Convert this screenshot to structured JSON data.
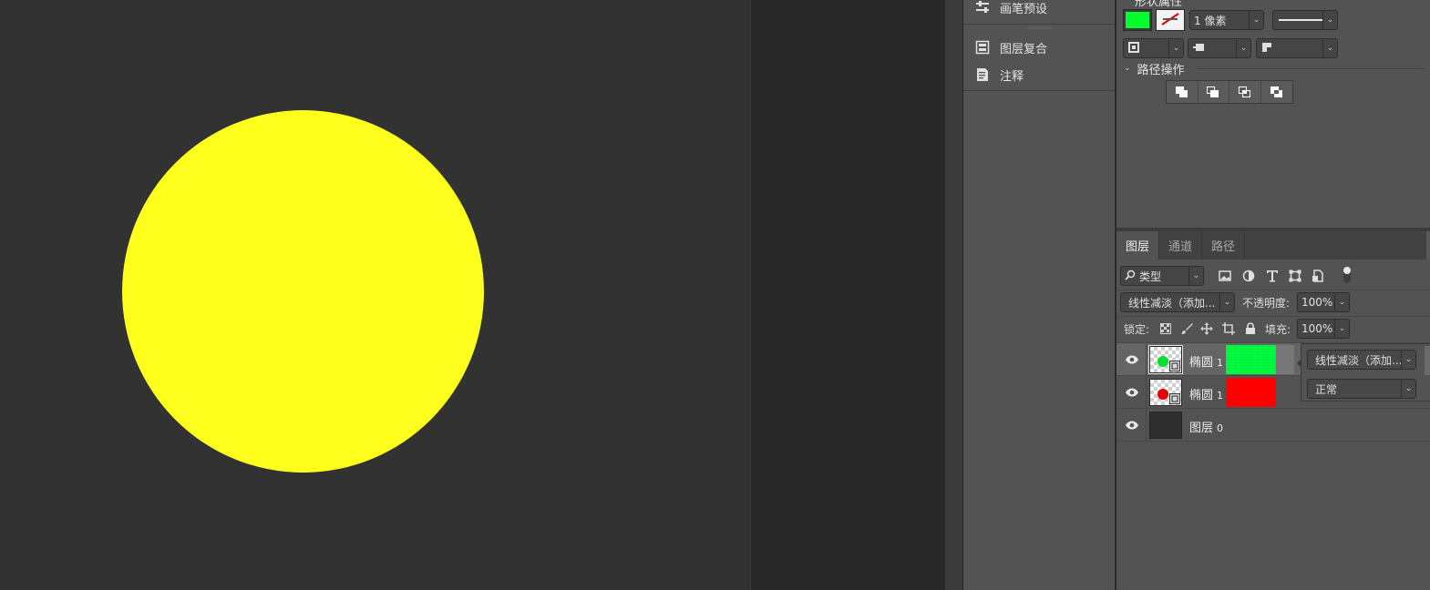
{
  "canvas": {
    "shape_color": "#ffff1e",
    "background": "#323232"
  },
  "iconic_panel": {
    "items": [
      {
        "label": "画笔预设",
        "icon": "brush-presets-icon"
      },
      {
        "label": "图层复合",
        "icon": "layer-comps-icon"
      },
      {
        "label": "注释",
        "icon": "notes-icon"
      }
    ]
  },
  "properties": {
    "title": "形状属性",
    "fill_color": "#00ff2c",
    "stroke_width": "1 像素",
    "path_ops_label": "路径操作"
  },
  "layers_panel": {
    "tabs": [
      {
        "label": "图层",
        "active": true
      },
      {
        "label": "通道",
        "active": false
      },
      {
        "label": "路径",
        "active": false
      }
    ],
    "filter": {
      "kind": "类型"
    },
    "blend_mode": "线性减淡（添加...",
    "opacity_label": "不透明度:",
    "opacity_value": "100%",
    "lock_label": "锁定:",
    "fill_label": "填充:",
    "fill_value": "100%",
    "layers": [
      {
        "name": "椭圆",
        "num": "1",
        "color": "#00ff40",
        "selected": true
      },
      {
        "name": "椭圆",
        "num": "1",
        "color": "#ff0000",
        "selected": false
      },
      {
        "name": "图层",
        "num": "0",
        "color": null,
        "selected": false
      }
    ],
    "blend_popup": {
      "options": [
        "线性减淡（添加...",
        "正常"
      ]
    }
  }
}
